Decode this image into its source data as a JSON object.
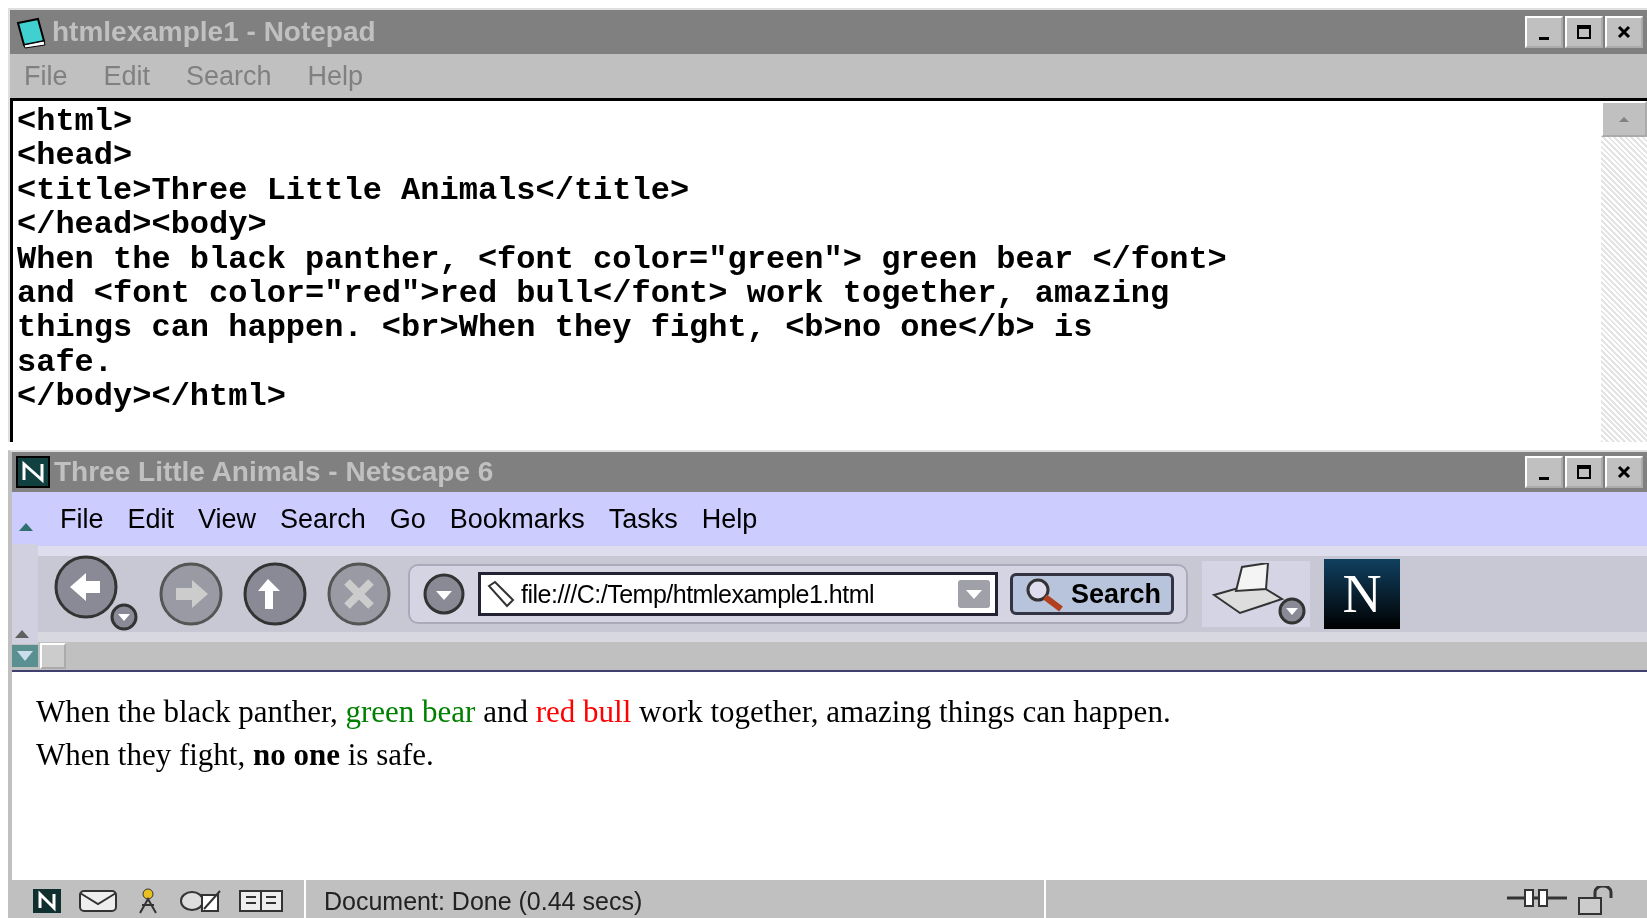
{
  "notepad": {
    "title": "htmlexample1 - Notepad",
    "menu": [
      "File",
      "Edit",
      "Search",
      "Help"
    ],
    "lines": [
      "<html>",
      "<head>",
      "<title>Three Little Animals</title>",
      "</head><body>",
      "When the black panther, <font color=\"green\"> green bear </font>",
      "and <font color=\"red\">red bull</font> work together, amazing",
      "things can happen. <br>When they fight, <b>no one</b> is",
      "safe.",
      "</body></html>"
    ]
  },
  "browser": {
    "title": "Three Little Animals - Netscape 6",
    "menu": [
      "File",
      "Edit",
      "View",
      "Search",
      "Go",
      "Bookmarks",
      "Tasks",
      "Help"
    ],
    "url": "file:///C:/Temp/htmlexample1.html",
    "search_button": "Search",
    "logo": "N",
    "content": [
      {
        "segments": [
          {
            "text": "When the black panther, ",
            "color": "#000000"
          },
          {
            "text": "green bear",
            "color": "#008000"
          },
          {
            "text": " and ",
            "color": "#000000"
          },
          {
            "text": "red bull",
            "color": "#ff0000"
          },
          {
            "text": " work together, amazing things can happen.",
            "color": "#000000"
          }
        ]
      },
      {
        "text": "When they fight, **no one** is safe."
      }
    ],
    "status": "Document: Done (0.44 secs)"
  }
}
